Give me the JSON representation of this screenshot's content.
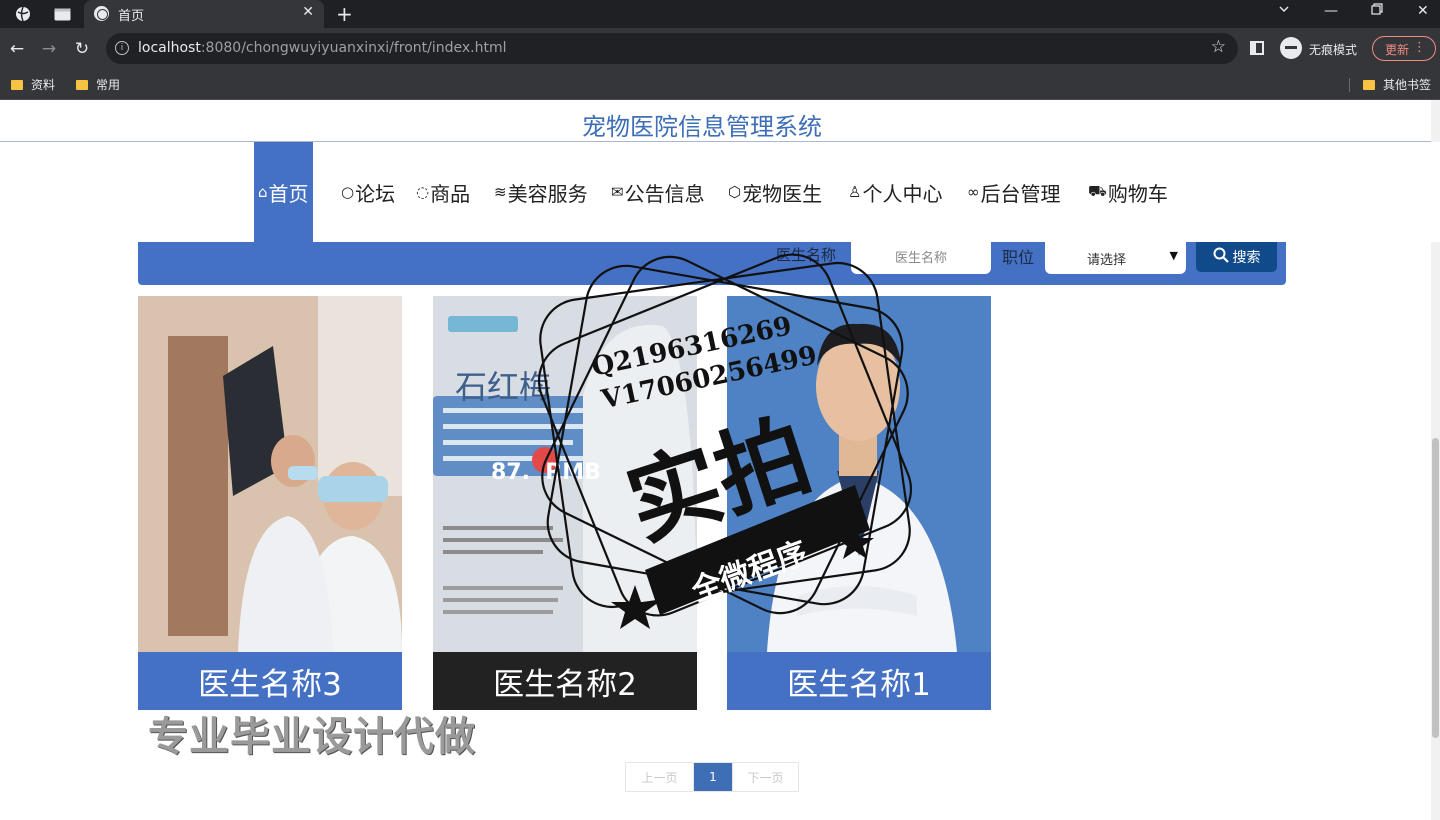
{
  "browser": {
    "tab_title": "首页",
    "url_host": "localhost",
    "url_rest": ":8080/chongwuyiyuanxinxi/front/index.html",
    "incognito_label": "无痕模式",
    "update_label": "更新",
    "bookmarks": [
      "资料",
      "常用"
    ],
    "other_bookmarks": "其他书签"
  },
  "site": {
    "title": "宠物医院信息管理系统"
  },
  "nav": {
    "items": [
      {
        "label": "首页",
        "icon": "home-icon"
      },
      {
        "label": "论坛",
        "icon": "chat-bubble-icon"
      },
      {
        "label": "商品",
        "icon": "palette-icon"
      },
      {
        "label": "美容服务",
        "icon": "layers-icon"
      },
      {
        "label": "公告信息",
        "icon": "mail-icon"
      },
      {
        "label": "宠物医生",
        "icon": "cube-icon"
      },
      {
        "label": "个人中心",
        "icon": "user-icon"
      },
      {
        "label": "后台管理",
        "icon": "link-icon"
      },
      {
        "label": "购物车",
        "icon": "cart-icon"
      }
    ]
  },
  "search": {
    "name_label": "医生名称",
    "name_placeholder": "医生名称",
    "position_label": "职位",
    "position_selected": "请选择",
    "button_label": "搜索"
  },
  "doctors": [
    {
      "name": "医生名称3"
    },
    {
      "name": "医生名称2",
      "poster_title": "石红梅",
      "poster_price": "87.  RMB"
    },
    {
      "name": "医生名称1"
    }
  ],
  "pagination": {
    "prev_label": "上一页",
    "current": "1",
    "next_label": "下一页"
  },
  "watermark": {
    "bottom_text": "专业毕业设计代做",
    "stamp_line1": "Q2196316269",
    "stamp_line2": "V17060256499",
    "stamp_main": "实拍",
    "stamp_banner": "全微程序"
  },
  "colors": {
    "primary": "#4471c4",
    "title": "#3e6eb6",
    "search_button": "#114a8a"
  }
}
